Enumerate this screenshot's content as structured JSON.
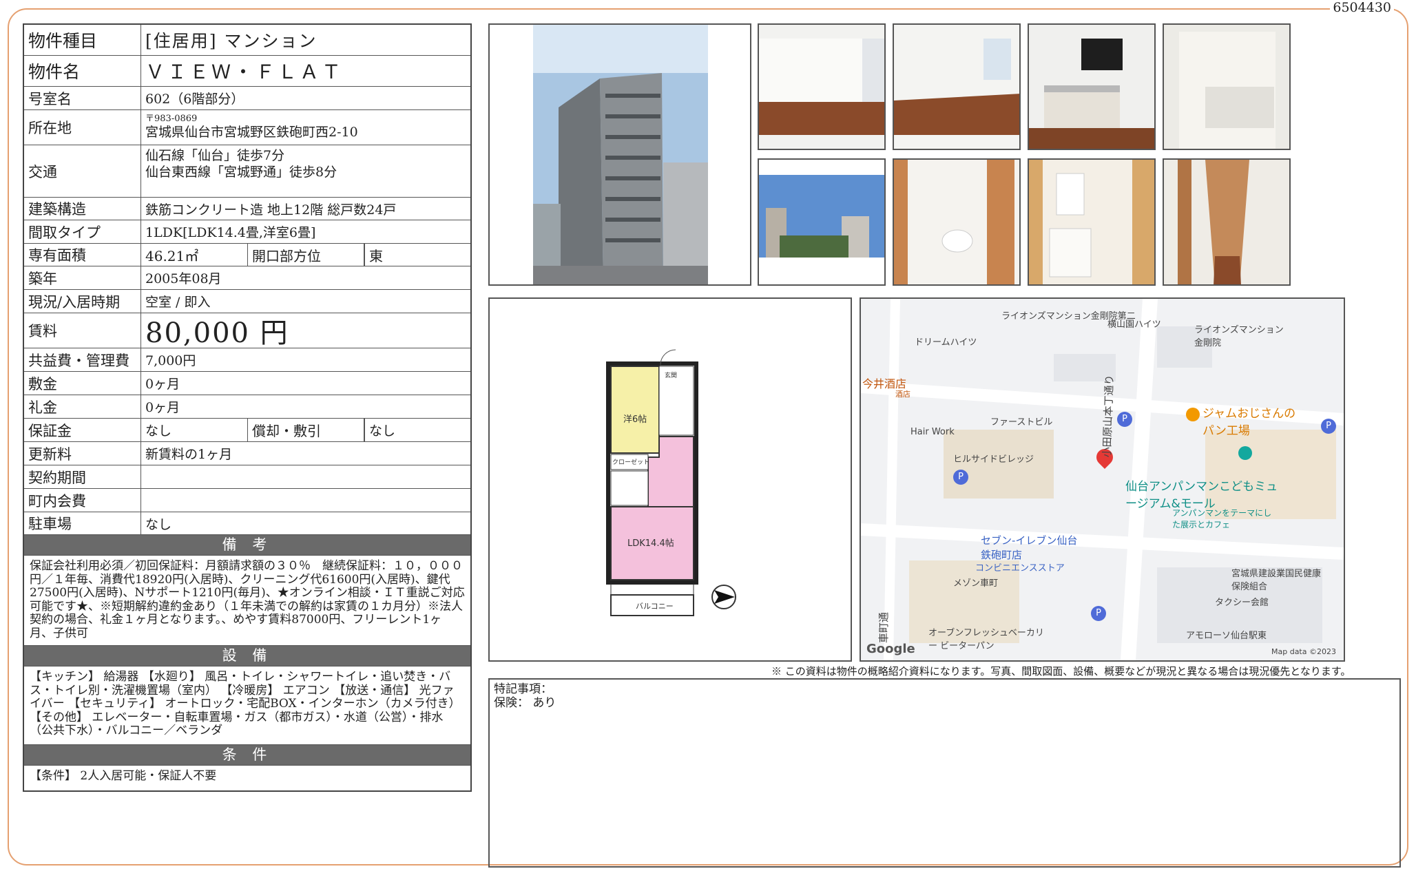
{
  "doc_id": "6504430",
  "rows": {
    "type": {
      "label": "物件種目",
      "value": "[住居用] マンション"
    },
    "name": {
      "label": "物件名",
      "value": "ＶＩＥＷ・ＦＬＡＴ"
    },
    "room": {
      "label": "号室名",
      "value": "602（6階部分）"
    },
    "address": {
      "label": "所在地",
      "postal": "〒983-0869",
      "line": "宮城県仙台市宮城野区鉄砲町西2-10"
    },
    "access": {
      "label": "交通",
      "line1": "仙石線「仙台」徒歩7分",
      "line2": "仙台東西線「宮城野通」徒歩8分"
    },
    "structure": {
      "label": "建築構造",
      "value": "鉄筋コンクリート造 地上12階 総戸数24戸"
    },
    "layout": {
      "label": "間取タイプ",
      "value": "1LDK[LDK14.4畳,洋室6畳]"
    },
    "area": {
      "label": "専有面積",
      "value": "46.21㎡",
      "sub_label": "開口部方位",
      "sub_value": "東"
    },
    "built": {
      "label": "築年",
      "value": "2005年08月"
    },
    "status": {
      "label": "現況/入居時期",
      "value": "空室 / 即入"
    },
    "rent": {
      "label": "賃料",
      "value": "80,000 円"
    },
    "mgmt": {
      "label": "共益費・管理費",
      "value": "7,000円"
    },
    "deposit": {
      "label": "敷金",
      "value": "0ヶ月"
    },
    "key_money": {
      "label": "礼金",
      "value": "0ヶ月"
    },
    "guarantee": {
      "label": "保証金",
      "value": "なし",
      "sub_label": "償却・敷引",
      "sub_value": "なし"
    },
    "renewal": {
      "label": "更新料",
      "value": "新賃料の1ヶ月"
    },
    "contract": {
      "label": "契約期間",
      "value": ""
    },
    "town_fee": {
      "label": "町内会費",
      "value": ""
    },
    "parking": {
      "label": "駐車場",
      "value": "なし"
    }
  },
  "sections": {
    "remarks_title": "備 考",
    "remarks_text": "保証会社利用必須／初回保証料：月額請求額の３０％　継続保証料：１０，０００円／１年毎、消費代18920円(入居時)、クリーニング代61600円(入居時)、鍵代27500円(入居時)、Nサポート1210円(毎月)、★オンライン相談・ＩＴ重説ご対応可能です★、※短期解約違約金あり（１年未満での解約は家賃の１カ月分）※法人契約の場合、礼金１ヶ月となります。、めやす賃料87000円、フリーレント1ヶ月、子供可",
    "equipment_title": "設 備",
    "equipment_text": "【キッチン】 給湯器 【水廻り】 風呂・トイレ・シャワートイレ・追い焚き・バス・トイレ別・洗濯機置場（室内） 【冷暖房】 エアコン 【放送・通信】 光ファイバー 【セキュリティ】 オートロック・宅配BOX・インターホン（カメラ付き） 【その他】 エレベーター・自転車置場・ガス（都市ガス）・水道（公営）・排水（公共下水）・バルコニー／ベランダ",
    "conditions_title": "条 件",
    "conditions_text": "【条件】 2人入居可能・保証人不要"
  },
  "floorplan": {
    "rooms": [
      "洋6帖",
      "LDK14.4帖",
      "クローゼット",
      "玄関",
      "バルコニー"
    ],
    "compass": "E"
  },
  "map": {
    "labels": [
      "ライオンズマンション金剛院第二",
      "横山園ハイツ",
      "ライオンズマンション金剛院",
      "ドリームハイツ",
      "今井酒店",
      "酒店",
      "ファーストビル",
      "Hair Work",
      "ジャムおじさんのパン工場",
      "ヒルサイドビレッジ",
      "仙台アンパンマンこどもミュージアム&モール",
      "アンパンマンをテーマにした展示とカフェ",
      "小田原山本丁通り",
      "セブン-イレブン仙台鉄砲町店",
      "コンビニエンスストア",
      "宮城県建設業国民健康保険組合",
      "メゾン車町",
      "タクシー会館",
      "車町通",
      "オーブンフレッシュベーカリー ビーターパン",
      "アモローソ仙台駅東",
      "Google",
      "Map data ©2023"
    ],
    "colors": {
      "pin": "#e53935",
      "poi": "#f29900",
      "parking": "#4f6bd8",
      "museum": "#13a89e"
    }
  },
  "footer": {
    "disclaimer": "※ この資料は物件の概略紹介資料になります。写真、間取図面、設備、概要などが現況と異なる場合は現況優先となります。",
    "special_label": "特記事項：",
    "insurance": "保険： あり"
  }
}
